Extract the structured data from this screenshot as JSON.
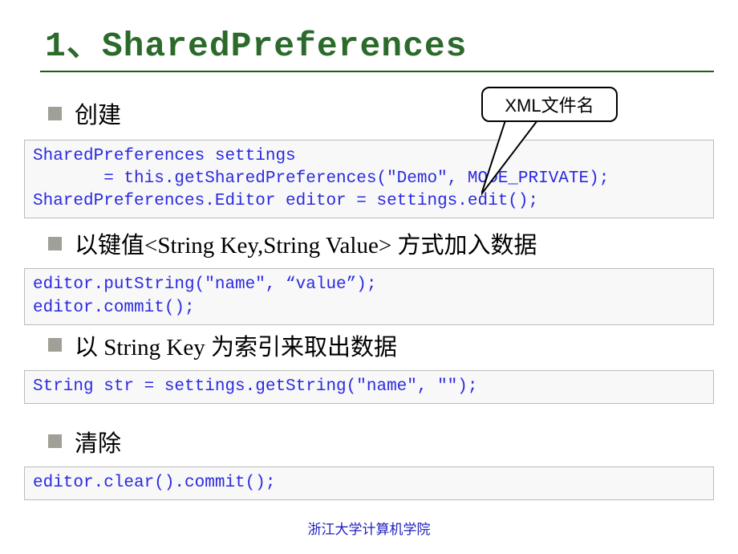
{
  "title": {
    "num": "1",
    "comma": "、",
    "name": "SharedPreferences"
  },
  "callout": "XML文件名",
  "sections": [
    {
      "bullet": "创建",
      "code": "SharedPreferences settings\n       = this.getSharedPreferences(\"Demo\", MODE_PRIVATE);\nSharedPreferences.Editor editor = settings.edit();"
    },
    {
      "bullet_prefix": "以键值",
      "bullet_latin": "<String Key,String Value> ",
      "bullet_suffix": "方式加入数据",
      "code": "editor.putString(\"name\", “value”);\neditor.commit();"
    },
    {
      "bullet_prefix": "以",
      "bullet_latin": " String Key ",
      "bullet_suffix": "为索引来取出数据",
      "code": "String str = settings.getString(\"name\", \"\");"
    },
    {
      "bullet": "清除",
      "code": "editor.clear().commit();"
    }
  ],
  "footer": "浙江大学计算机学院"
}
